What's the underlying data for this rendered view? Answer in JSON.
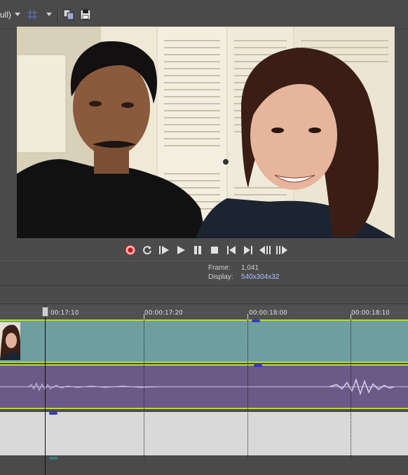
{
  "toolbar": {
    "quality_text": "ull)",
    "icons": [
      "dropdown-arrow-icon",
      "overlay-grid-icon",
      "copy-snapshot-icon",
      "save-snapshot-icon"
    ]
  },
  "transport": {
    "buttons": [
      "record",
      "loop",
      "play-from-start",
      "play",
      "pause",
      "stop",
      "go-to-start",
      "go-to-end",
      "previous-frame",
      "next-frame"
    ]
  },
  "info": {
    "frame_label": "Frame:",
    "frame_value": "1,041",
    "display_label": "Display:",
    "display_value": "540x304x32"
  },
  "timeline": {
    "ticks": [
      "00:17:10",
      "00:00:17:20",
      "00:00:18:00",
      "00:00:18:10"
    ]
  },
  "colors": {
    "video_track": "#6e9ea0",
    "audio_track": "#6b5987",
    "track_border": "#b8d84a",
    "record_button": "#e04040"
  }
}
